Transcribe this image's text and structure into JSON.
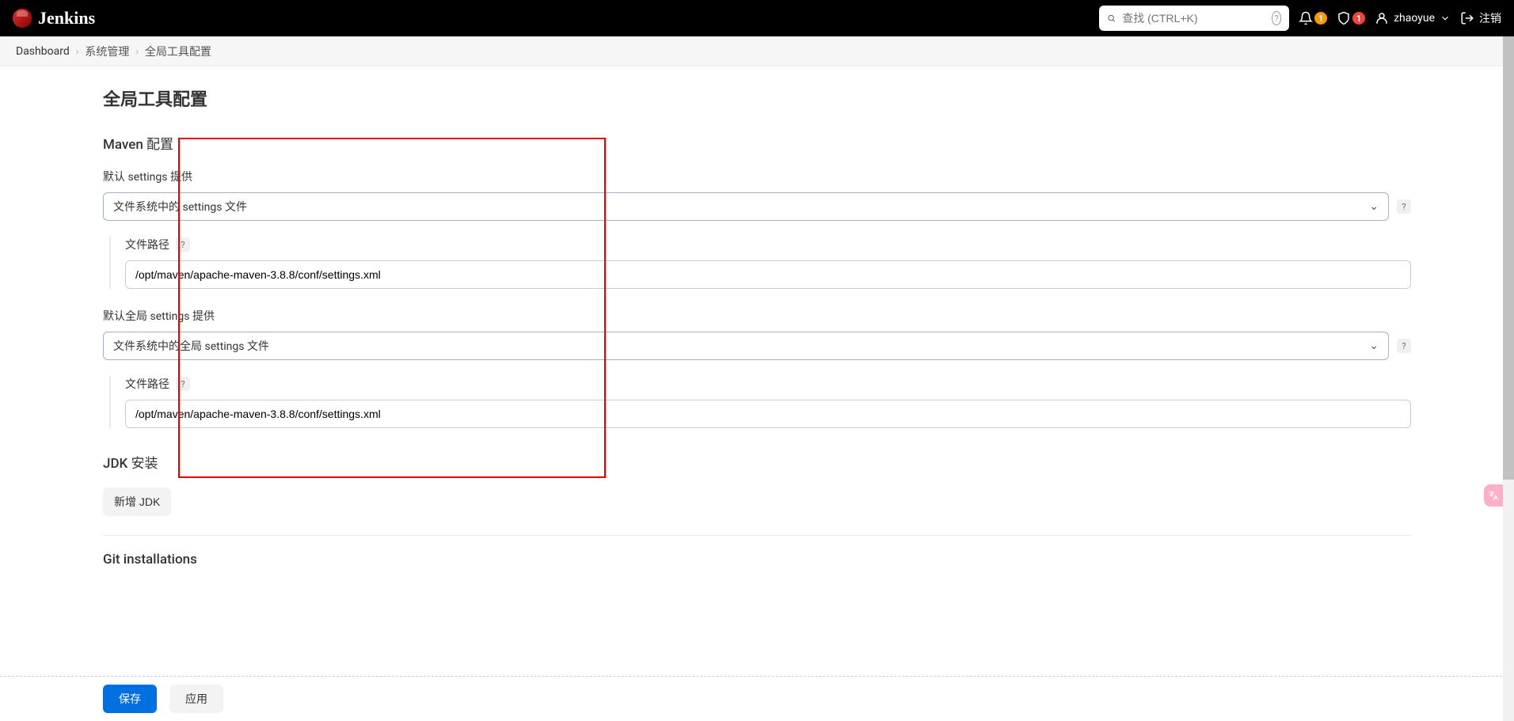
{
  "header": {
    "brand": "Jenkins",
    "search_placeholder": "查找 (CTRL+K)",
    "notif_count": "1",
    "security_count": "1",
    "username": "zhaoyue",
    "logout_label": "注销"
  },
  "breadcrumb": {
    "items": [
      "Dashboard",
      "系统管理",
      "全局工具配置"
    ]
  },
  "page": {
    "title": "全局工具配置",
    "maven_section": "Maven 配置",
    "default_settings_label": "默认 settings 提供",
    "default_settings_value": "文件系统中的 settings 文件",
    "file_path_label": "文件路径",
    "file_path_value_1": "/opt/maven/apache-maven-3.8.8/conf/settings.xml",
    "default_global_settings_label": "默认全局 settings 提供",
    "default_global_settings_value": "文件系统中的全局 settings 文件",
    "file_path_value_2": "/opt/maven/apache-maven-3.8.8/conf/settings.xml",
    "jdk_section": "JDK 安装",
    "add_jdk_label": "新增 JDK",
    "git_section": "Git installations"
  },
  "buttons": {
    "save": "保存",
    "apply": "应用"
  }
}
